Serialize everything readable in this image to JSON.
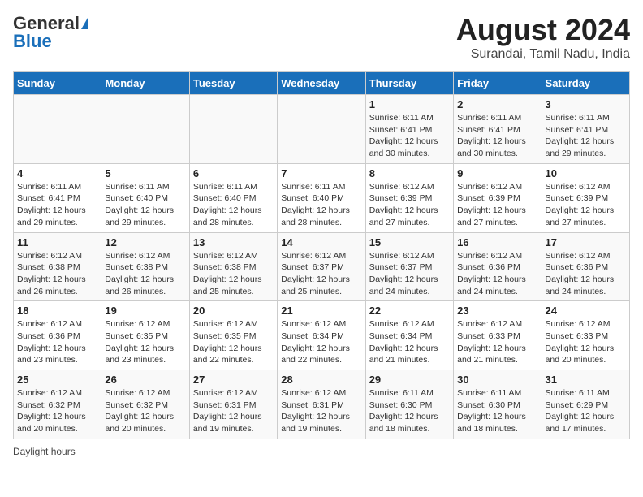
{
  "logo": {
    "general": "General",
    "blue": "Blue"
  },
  "title": "August 2024",
  "subtitle": "Surandai, Tamil Nadu, India",
  "days_of_week": [
    "Sunday",
    "Monday",
    "Tuesday",
    "Wednesday",
    "Thursday",
    "Friday",
    "Saturday"
  ],
  "weeks": [
    [
      {
        "day": "",
        "info": ""
      },
      {
        "day": "",
        "info": ""
      },
      {
        "day": "",
        "info": ""
      },
      {
        "day": "",
        "info": ""
      },
      {
        "day": "1",
        "info": "Sunrise: 6:11 AM\nSunset: 6:41 PM\nDaylight: 12 hours\nand 30 minutes."
      },
      {
        "day": "2",
        "info": "Sunrise: 6:11 AM\nSunset: 6:41 PM\nDaylight: 12 hours\nand 30 minutes."
      },
      {
        "day": "3",
        "info": "Sunrise: 6:11 AM\nSunset: 6:41 PM\nDaylight: 12 hours\nand 29 minutes."
      }
    ],
    [
      {
        "day": "4",
        "info": "Sunrise: 6:11 AM\nSunset: 6:41 PM\nDaylight: 12 hours\nand 29 minutes."
      },
      {
        "day": "5",
        "info": "Sunrise: 6:11 AM\nSunset: 6:40 PM\nDaylight: 12 hours\nand 29 minutes."
      },
      {
        "day": "6",
        "info": "Sunrise: 6:11 AM\nSunset: 6:40 PM\nDaylight: 12 hours\nand 28 minutes."
      },
      {
        "day": "7",
        "info": "Sunrise: 6:11 AM\nSunset: 6:40 PM\nDaylight: 12 hours\nand 28 minutes."
      },
      {
        "day": "8",
        "info": "Sunrise: 6:12 AM\nSunset: 6:39 PM\nDaylight: 12 hours\nand 27 minutes."
      },
      {
        "day": "9",
        "info": "Sunrise: 6:12 AM\nSunset: 6:39 PM\nDaylight: 12 hours\nand 27 minutes."
      },
      {
        "day": "10",
        "info": "Sunrise: 6:12 AM\nSunset: 6:39 PM\nDaylight: 12 hours\nand 27 minutes."
      }
    ],
    [
      {
        "day": "11",
        "info": "Sunrise: 6:12 AM\nSunset: 6:38 PM\nDaylight: 12 hours\nand 26 minutes."
      },
      {
        "day": "12",
        "info": "Sunrise: 6:12 AM\nSunset: 6:38 PM\nDaylight: 12 hours\nand 26 minutes."
      },
      {
        "day": "13",
        "info": "Sunrise: 6:12 AM\nSunset: 6:38 PM\nDaylight: 12 hours\nand 25 minutes."
      },
      {
        "day": "14",
        "info": "Sunrise: 6:12 AM\nSunset: 6:37 PM\nDaylight: 12 hours\nand 25 minutes."
      },
      {
        "day": "15",
        "info": "Sunrise: 6:12 AM\nSunset: 6:37 PM\nDaylight: 12 hours\nand 24 minutes."
      },
      {
        "day": "16",
        "info": "Sunrise: 6:12 AM\nSunset: 6:36 PM\nDaylight: 12 hours\nand 24 minutes."
      },
      {
        "day": "17",
        "info": "Sunrise: 6:12 AM\nSunset: 6:36 PM\nDaylight: 12 hours\nand 24 minutes."
      }
    ],
    [
      {
        "day": "18",
        "info": "Sunrise: 6:12 AM\nSunset: 6:36 PM\nDaylight: 12 hours\nand 23 minutes."
      },
      {
        "day": "19",
        "info": "Sunrise: 6:12 AM\nSunset: 6:35 PM\nDaylight: 12 hours\nand 23 minutes."
      },
      {
        "day": "20",
        "info": "Sunrise: 6:12 AM\nSunset: 6:35 PM\nDaylight: 12 hours\nand 22 minutes."
      },
      {
        "day": "21",
        "info": "Sunrise: 6:12 AM\nSunset: 6:34 PM\nDaylight: 12 hours\nand 22 minutes."
      },
      {
        "day": "22",
        "info": "Sunrise: 6:12 AM\nSunset: 6:34 PM\nDaylight: 12 hours\nand 21 minutes."
      },
      {
        "day": "23",
        "info": "Sunrise: 6:12 AM\nSunset: 6:33 PM\nDaylight: 12 hours\nand 21 minutes."
      },
      {
        "day": "24",
        "info": "Sunrise: 6:12 AM\nSunset: 6:33 PM\nDaylight: 12 hours\nand 20 minutes."
      }
    ],
    [
      {
        "day": "25",
        "info": "Sunrise: 6:12 AM\nSunset: 6:32 PM\nDaylight: 12 hours\nand 20 minutes."
      },
      {
        "day": "26",
        "info": "Sunrise: 6:12 AM\nSunset: 6:32 PM\nDaylight: 12 hours\nand 20 minutes."
      },
      {
        "day": "27",
        "info": "Sunrise: 6:12 AM\nSunset: 6:31 PM\nDaylight: 12 hours\nand 19 minutes."
      },
      {
        "day": "28",
        "info": "Sunrise: 6:12 AM\nSunset: 6:31 PM\nDaylight: 12 hours\nand 19 minutes."
      },
      {
        "day": "29",
        "info": "Sunrise: 6:11 AM\nSunset: 6:30 PM\nDaylight: 12 hours\nand 18 minutes."
      },
      {
        "day": "30",
        "info": "Sunrise: 6:11 AM\nSunset: 6:30 PM\nDaylight: 12 hours\nand 18 minutes."
      },
      {
        "day": "31",
        "info": "Sunrise: 6:11 AM\nSunset: 6:29 PM\nDaylight: 12 hours\nand 17 minutes."
      }
    ]
  ],
  "footer": "Daylight hours"
}
